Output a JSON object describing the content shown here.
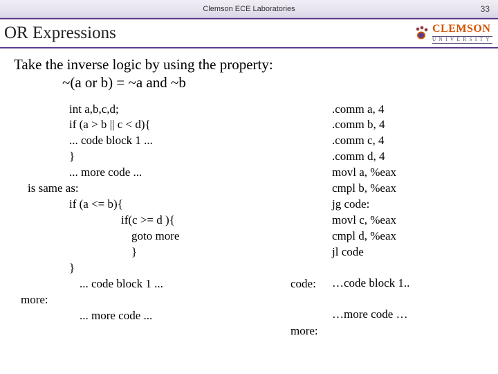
{
  "header": {
    "lab_name": "Clemson ECE Laboratories",
    "page_number": "33"
  },
  "title": "OR Expressions",
  "logo": {
    "main": "CLEMSON",
    "sub": "UNIVERSITY"
  },
  "intro": {
    "line1": "Take the inverse logic by using the property:",
    "line2": "~(a or b) = ~a and ~b"
  },
  "left": {
    "l1": "int a,b,c,d;",
    "l2": "if (a > b || c < d){",
    "l3": " ... code block 1 ...",
    "l4": "}",
    "l5": " ... more code ...",
    "same": "is same as:",
    "s1": "if (a <= b){",
    "s2": "if(c >= d ){",
    "s3": "goto more",
    "s4": "}",
    "s5": "}",
    "s6": " ... code block 1 ...",
    "more_label": "more:",
    "s7": " ... more code ..."
  },
  "right": {
    "labels": {
      "code": "code:",
      "more": "more:"
    },
    "a1": ".comm a, 4",
    "a2": ".comm b, 4",
    "a3": ".comm c, 4",
    "a4": ".comm d, 4",
    "a5": "movl a, %eax",
    "a6": "cmpl b, %eax",
    "a7": "jg code:",
    "a8": "movl c, %eax",
    "a9": "cmpl d, %eax",
    "a10": "jl code",
    "a11": "…code block 1..",
    "a12": "…more code …"
  }
}
